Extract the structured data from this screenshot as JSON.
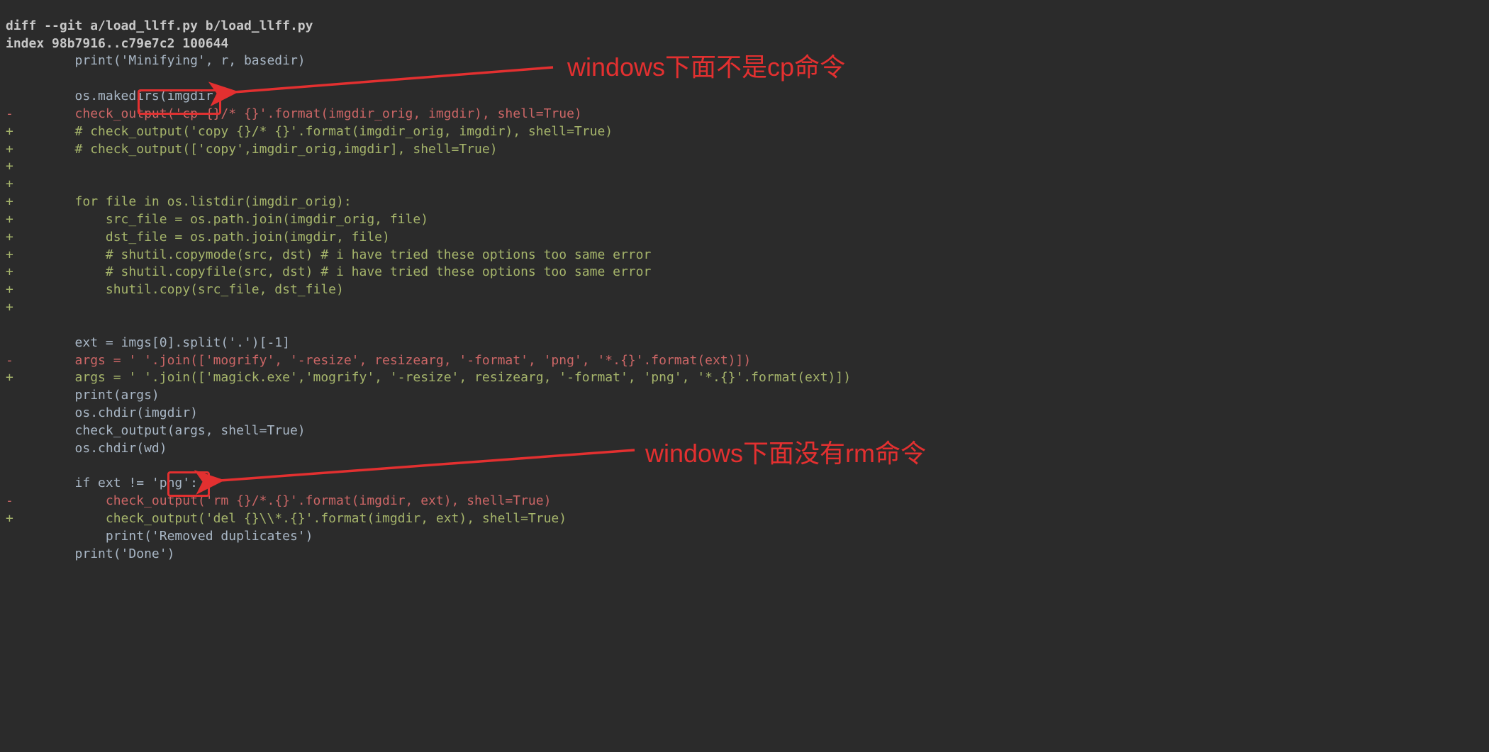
{
  "top_cut_line": "                                 ",
  "header1": "diff --git a/load_llff.py b/load_llff.py",
  "header2": "index 98b7916..c79e7c2 100644",
  "lines": {
    "l00": "         print('Minifying', r, basedir)",
    "l01": " ",
    "l02": "         os.makedirs(imgdir)",
    "l03": "-        check_output('cp {}/* {}'.format(imgdir_orig, imgdir), shell=True)",
    "l04": "+        # check_output('copy {}/* {}'.format(imgdir_orig, imgdir), shell=True)",
    "l05": "+        # check_output(['copy',imgdir_orig,imgdir], shell=True)",
    "l06": "+",
    "l07": "+",
    "l08": "+        for file in os.listdir(imgdir_orig):",
    "l09": "+            src_file = os.path.join(imgdir_orig, file)",
    "l10": "+            dst_file = os.path.join(imgdir, file)",
    "l11": "+            # shutil.copymode(src, dst) # i have tried these options too same error",
    "l12": "+            # shutil.copyfile(src, dst) # i have tried these options too same error",
    "l13": "+            shutil.copy(src_file, dst_file)",
    "l14": "+",
    "l15": " ",
    "l16": "         ext = imgs[0].split('.')[-1]",
    "l17": "-        args = ' '.join(['mogrify', '-resize', resizearg, '-format', 'png', '*.{}'.format(ext)])",
    "l18": "+        args = ' '.join(['magick.exe','mogrify', '-resize', resizearg, '-format', 'png', '*.{}'.format(ext)])",
    "l19": "         print(args)",
    "l20": "         os.chdir(imgdir)",
    "l21": "         check_output(args, shell=True)",
    "l22": "         os.chdir(wd)",
    "l23": " ",
    "l24": "         if ext != 'png':",
    "l25": "-            check_output('rm {}/*.{}'.format(imgdir, ext), shell=True)",
    "l26": "+            check_output('del {}\\\\*.{}'.format(imgdir, ext), shell=True)",
    "l27": "             print('Removed duplicates')",
    "l28": "         print('Done')"
  },
  "annotations": {
    "a1": "windows下面不是cp命令",
    "a2": "windows下面没有rm命令"
  }
}
